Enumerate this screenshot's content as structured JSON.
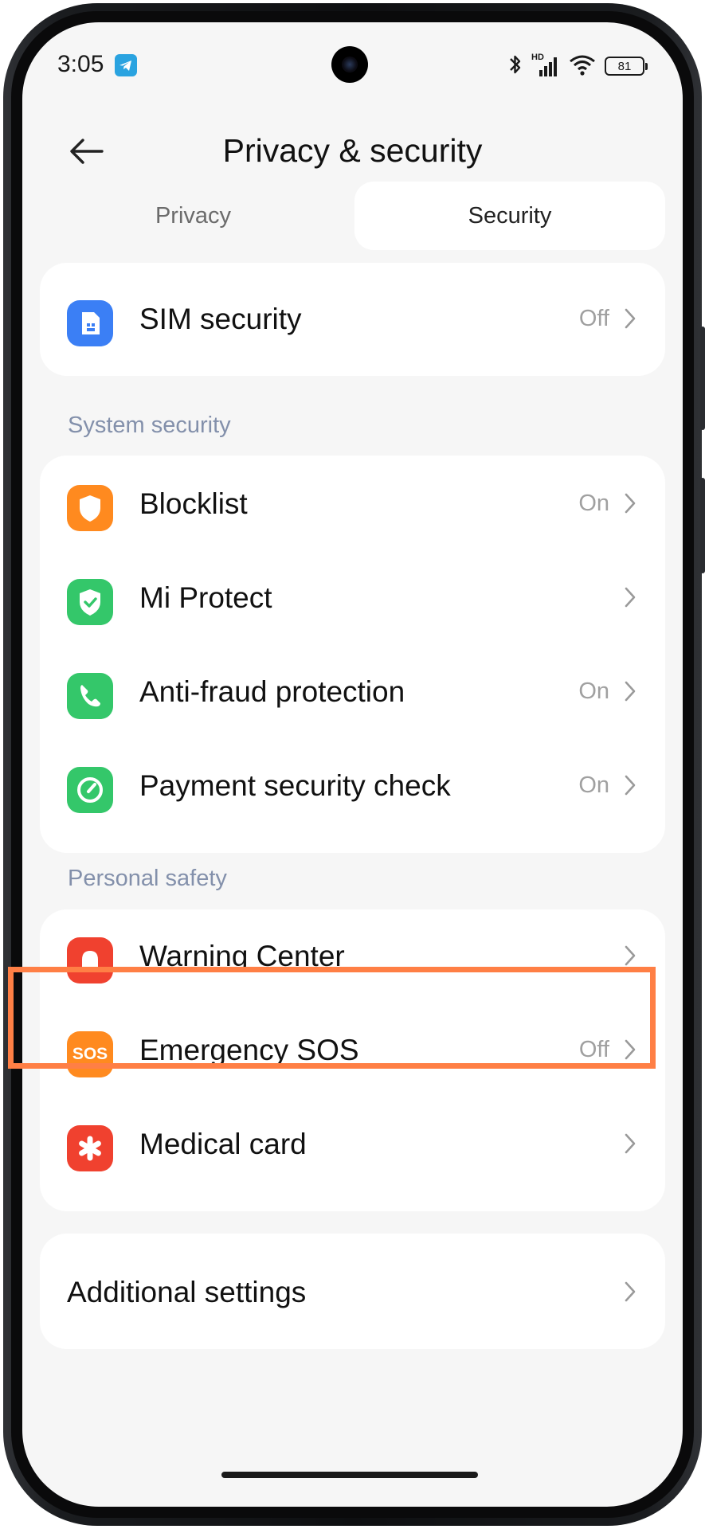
{
  "status_bar": {
    "time": "3:05",
    "network_badge": "HD",
    "battery_level": "81",
    "icons": [
      "telegram-icon",
      "bluetooth-icon",
      "signal-icon",
      "wifi-icon",
      "battery-icon"
    ]
  },
  "header": {
    "title": "Privacy & security"
  },
  "tabs": [
    {
      "label": "Privacy",
      "selected": false
    },
    {
      "label": "Security",
      "selected": true
    }
  ],
  "sim": {
    "label": "SIM security",
    "value": "Off",
    "icon": "sim-card-icon"
  },
  "system_security": {
    "heading": "System security",
    "items": [
      {
        "label": "Blocklist",
        "value": "On",
        "icon": "shield-icon"
      },
      {
        "label": "Mi Protect",
        "value": "",
        "icon": "shield-check-icon"
      },
      {
        "label": "Anti-fraud protection",
        "value": "On",
        "icon": "phone-icon"
      },
      {
        "label": "Payment security check",
        "value": "On",
        "icon": "payment-check-icon"
      }
    ]
  },
  "personal_safety": {
    "heading": "Personal safety",
    "items": [
      {
        "label": "Warning Center",
        "value": "",
        "icon": "alarm-icon"
      },
      {
        "label": "Emergency SOS",
        "value": "Off",
        "icon": "sos-icon",
        "icon_text": "SOS"
      },
      {
        "label": "Medical card",
        "value": "",
        "icon": "medical-asterisk-icon"
      }
    ]
  },
  "additional": {
    "label": "Additional settings"
  },
  "colors": {
    "background": "#f6f6f6",
    "card": "#ffffff",
    "section_heading": "#8390ab",
    "highlight": "#ff7f45",
    "sim_icon": "#3b7ff5",
    "orange_icon": "#ff8a1f",
    "green_icon": "#34c76a",
    "red_icon": "#f0412f"
  }
}
